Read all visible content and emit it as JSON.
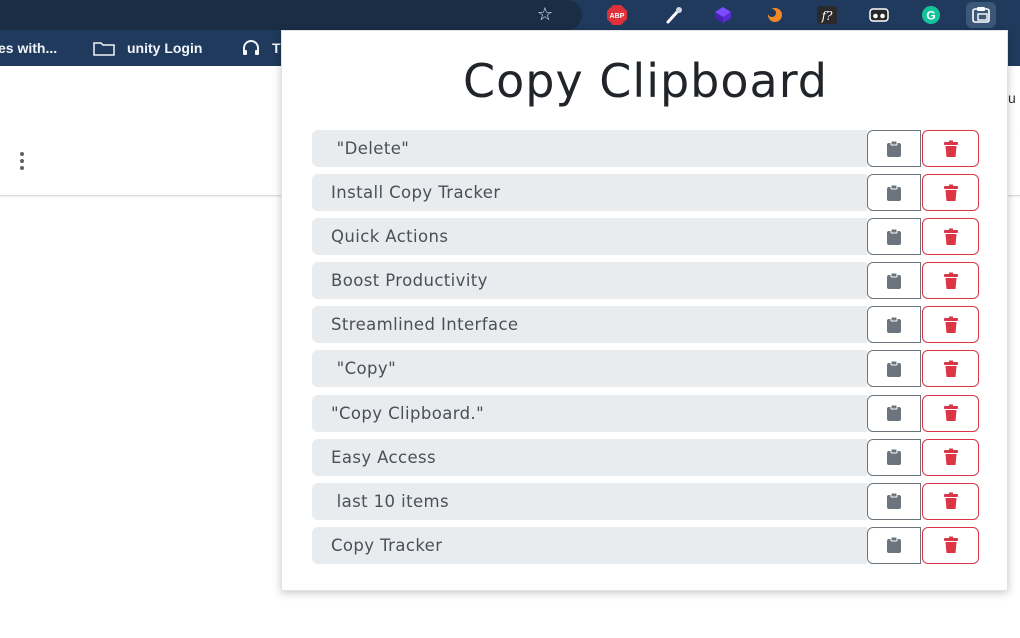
{
  "browser": {
    "bookmarks": [
      {
        "label": "es with...",
        "icon": "none"
      },
      {
        "label": "unity Login",
        "icon": "folder-icon"
      },
      {
        "label": "T",
        "icon": "headset-icon"
      }
    ],
    "extensions": [
      {
        "name": "abp-icon",
        "label": "ABP",
        "color": "#e0313a"
      },
      {
        "name": "eyedropper-icon",
        "label": "",
        "color": "#ffffff"
      },
      {
        "name": "cube-icon",
        "label": "",
        "color": "#5b2bd9"
      },
      {
        "name": "orange-swirl-icon",
        "label": "",
        "color": "#f28b26"
      },
      {
        "name": "font-icon",
        "label": "f?",
        "color": "#ffffff"
      },
      {
        "name": "mask-icon",
        "label": "",
        "color": "#ffffff"
      },
      {
        "name": "grammarly-icon",
        "label": "G",
        "color": "#15c39a"
      },
      {
        "name": "copy-clipboard-ext-icon",
        "label": "",
        "color": "#ffffff"
      }
    ],
    "peek_text": "u"
  },
  "popup": {
    "title": "Copy Clipboard",
    "items": [
      {
        "text": " \"Delete\""
      },
      {
        "text": "Install Copy Tracker"
      },
      {
        "text": "Quick Actions"
      },
      {
        "text": "Boost Productivity"
      },
      {
        "text": "Streamlined Interface"
      },
      {
        "text": " \"Copy\""
      },
      {
        "text": "\"Copy Clipboard.\""
      },
      {
        "text": "Easy Access"
      },
      {
        "text": " last 10 items"
      },
      {
        "text": "Copy Tracker"
      }
    ],
    "colors": {
      "copy_icon": "#6c757d",
      "delete_icon": "#dc3545",
      "item_bg": "#e9ecef"
    }
  }
}
